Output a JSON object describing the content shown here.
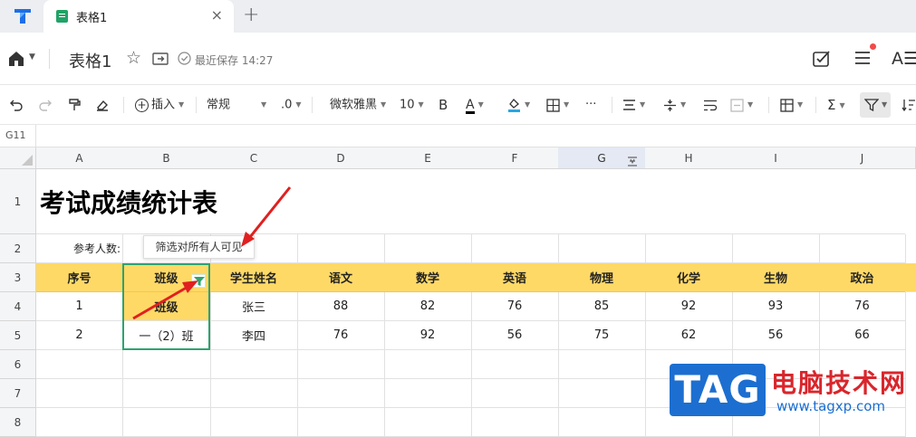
{
  "tabs": [
    {
      "title": "表格1",
      "close": "×"
    }
  ],
  "new_tab": "+",
  "header": {
    "doc_title": "表格1",
    "saved_text": "最近保存 14:27",
    "star": "☆",
    "font_btn": "A☰"
  },
  "toolbar": {
    "insert": "插入",
    "format": "常规",
    "decimal": ".0",
    "font": "微软雅黑",
    "size": "10",
    "bold": "B",
    "font_color": "A",
    "more": "···",
    "sum": "Σ"
  },
  "namebox": "G11",
  "columns": [
    "A",
    "B",
    "C",
    "D",
    "E",
    "F",
    "G",
    "H",
    "I",
    "J"
  ],
  "rows": [
    "1",
    "2",
    "3",
    "4",
    "5",
    "6",
    "7",
    "8"
  ],
  "sheet": {
    "title": "考试成绩统计表",
    "participants_label": "参考人数:",
    "headers": [
      "序号",
      "班级",
      "学生姓名",
      "语文",
      "数学",
      "英语",
      "物理",
      "化学",
      "生物",
      "政治"
    ],
    "data": [
      [
        "1",
        "班级",
        "张三",
        "88",
        "82",
        "76",
        "85",
        "92",
        "93",
        "76"
      ],
      [
        "2",
        "一（2）班",
        "李四",
        "76",
        "92",
        "56",
        "75",
        "62",
        "56",
        "66"
      ]
    ]
  },
  "tooltip": "筛选对所有人可见",
  "watermark": {
    "tag": "TAG",
    "name": "电脑技术网",
    "url": "www.tagxp.com"
  },
  "colors": {
    "header_fill": "#ffd966",
    "selection": "#2ea36f",
    "arrow": "#e02020",
    "brand": "#1c6fd0"
  }
}
